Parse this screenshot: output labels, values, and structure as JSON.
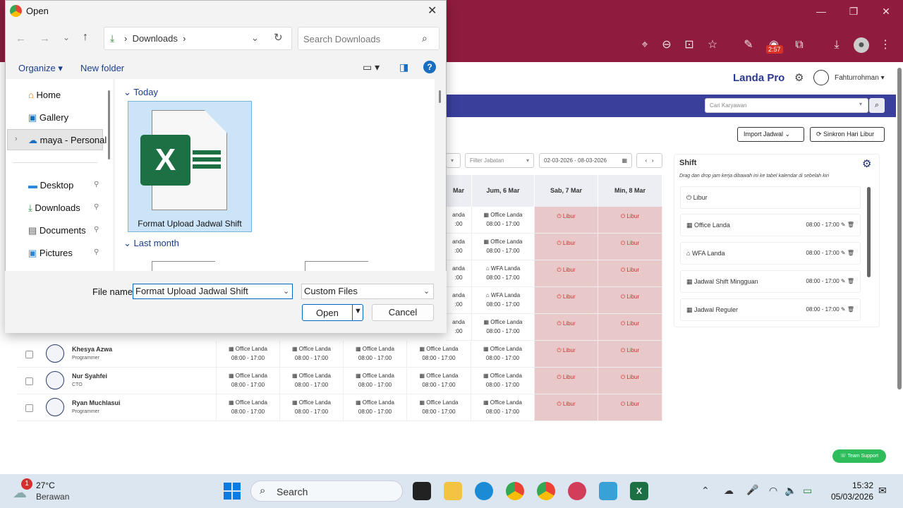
{
  "browser": {
    "profile_badge": "2:57",
    "window_controls": [
      "minimize-icon",
      "restore-icon",
      "close-icon"
    ]
  },
  "app": {
    "brand": "Landa Pro",
    "user": "Fahturrohman",
    "employee_search_placeholder": "Cari Karyawan",
    "import_label": "Import Jadwal",
    "sync_label": "Sinkron Hari Libur",
    "filter_position": "Filter Jabatan",
    "date_range": "02-03-2026 - 08-03-2026",
    "support_label": "Team Support"
  },
  "schedule": {
    "headers": [
      "Mar",
      "Jum, 6 Mar",
      "Sab, 7 Mar",
      "Min, 8 Mar"
    ],
    "off_label": "Libur",
    "employees": [
      {
        "name": "Khesya Azwa",
        "role": "Programmer"
      },
      {
        "name": "Nur Syahfei",
        "role": "CTO"
      },
      {
        "name": "Ryan Muchlasui",
        "role": "Programmer"
      }
    ],
    "office_label": "Office Landa",
    "wfa_label": "WFA Landa",
    "hours": "08:00 - 17:00"
  },
  "shift_panel": {
    "title": "Shift",
    "hint": "Drag dan drop jam kerja dibawah ini ke tabel kalendar di sebelah kiri",
    "off_item": "Libur",
    "items": [
      {
        "name": "Office Landa",
        "time": "08:00 - 17:00"
      },
      {
        "name": "WFA Landa",
        "time": "08:00 - 17:00"
      },
      {
        "name": "Jadwal Shift Mingguan",
        "time": "08:00 - 17:00"
      },
      {
        "name": "Jadwal Reguler",
        "time": "08:00 - 17:00"
      }
    ]
  },
  "dialog": {
    "title": "Open",
    "path": "Downloads",
    "search_placeholder": "Search Downloads",
    "organize": "Organize",
    "new_folder": "New folder",
    "nav": [
      "Home",
      "Gallery",
      "maya - Personal",
      "Desktop",
      "Downloads",
      "Documents",
      "Pictures"
    ],
    "group_today": "Today",
    "group_last_month": "Last month",
    "selected_file": "Format Upload Jadwal Shift",
    "file_name_label": "File name:",
    "file_name_value": "Format Upload Jadwal Shift",
    "file_type": "Custom Files",
    "open_label": "Open",
    "cancel_label": "Cancel"
  },
  "taskbar": {
    "weather_temp": "27°C",
    "weather_desc": "Berawan",
    "weather_badge": "1",
    "search_label": "Search",
    "time": "15:32",
    "date": "05/03/2026"
  }
}
